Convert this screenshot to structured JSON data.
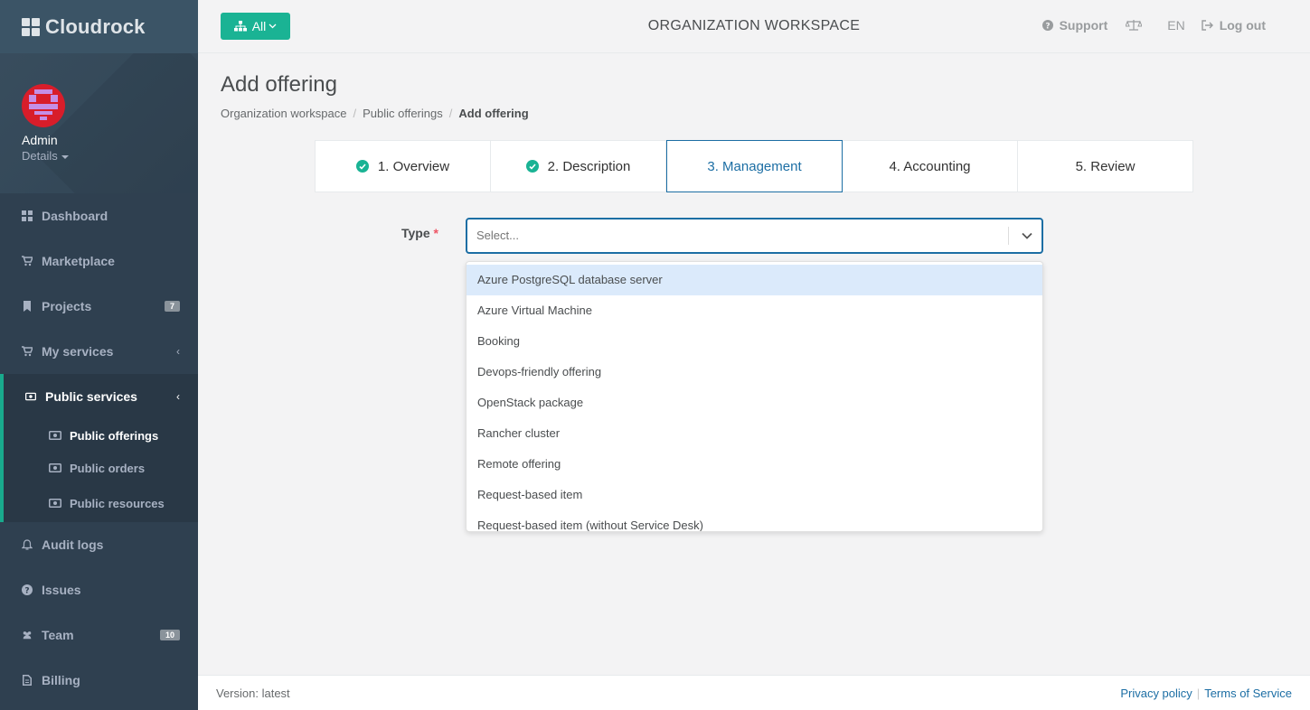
{
  "app": {
    "name": "Cloudrock"
  },
  "profile": {
    "name": "Admin",
    "details_label": "Details"
  },
  "sidebar": {
    "items": [
      {
        "label": "Dashboard",
        "icon": "dashboard-icon"
      },
      {
        "label": "Marketplace",
        "icon": "cart-icon"
      },
      {
        "label": "Projects",
        "icon": "bookmark-icon",
        "badge": "7"
      },
      {
        "label": "My services",
        "icon": "cart-icon"
      },
      {
        "label": "Public services",
        "icon": "money-icon"
      },
      {
        "label": "Audit logs",
        "icon": "bell-icon"
      },
      {
        "label": "Issues",
        "icon": "question-icon"
      },
      {
        "label": "Team",
        "icon": "users-icon",
        "badge": "10"
      },
      {
        "label": "Billing",
        "icon": "file-icon"
      }
    ],
    "subitems": [
      {
        "label": "Public offerings"
      },
      {
        "label": "Public orders"
      },
      {
        "label": "Public resources"
      }
    ],
    "colors": {
      "background": "#2f4050",
      "active_accent": "#19aa8d"
    }
  },
  "topbar": {
    "scope_button": "All",
    "workspace_title": "ORGANIZATION WORKSPACE",
    "support": "Support",
    "language": "EN",
    "logout": "Log out"
  },
  "page": {
    "title": "Add offering",
    "breadcrumb": [
      "Organization workspace",
      "Public offerings",
      "Add offering"
    ]
  },
  "wizard": {
    "steps": [
      {
        "label": "1. Overview",
        "done": true
      },
      {
        "label": "2. Description",
        "done": true
      },
      {
        "label": "3. Management",
        "current": true
      },
      {
        "label": "4. Accounting"
      },
      {
        "label": "5. Review"
      }
    ]
  },
  "form": {
    "type_label": "Type",
    "required_mark": "*",
    "select_placeholder": "Select...",
    "options": [
      "Azure PostgreSQL database server",
      "Azure Virtual Machine",
      "Booking",
      "Devops-friendly offering",
      "OpenStack package",
      "Rancher cluster",
      "Remote offering",
      "Request-based item",
      "Request-based item (without Service Desk)"
    ]
  },
  "footer": {
    "version": "Version: latest",
    "privacy": "Privacy policy",
    "terms": "Terms of Service"
  },
  "colors": {
    "accent": "#1ab394",
    "primary": "#1c6ea4",
    "highlight": "#dbeafb"
  }
}
